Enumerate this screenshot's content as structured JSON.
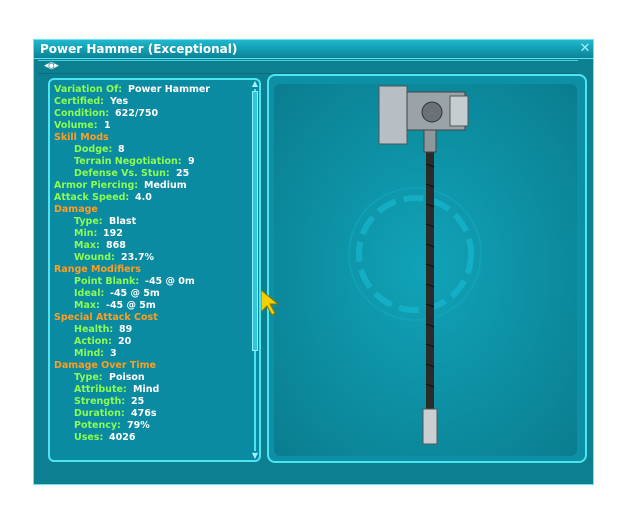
{
  "window": {
    "title": "Power Hammer (Exceptional)"
  },
  "stats": [
    {
      "type": "kv",
      "indent": 0,
      "label": "Variation Of:",
      "value": "Power Hammer"
    },
    {
      "type": "kv",
      "indent": 0,
      "label": "Certified:",
      "value": "Yes"
    },
    {
      "type": "kv",
      "indent": 0,
      "label": "Condition:",
      "value": "622/750"
    },
    {
      "type": "kv",
      "indent": 0,
      "label": "Volume:",
      "value": "1"
    },
    {
      "type": "header",
      "label": "Skill Mods"
    },
    {
      "type": "kv",
      "indent": 1,
      "label": "Dodge:",
      "value": "8"
    },
    {
      "type": "kv",
      "indent": 1,
      "label": "Terrain Negotiation:",
      "value": "9"
    },
    {
      "type": "kv",
      "indent": 1,
      "label": "Defense Vs. Stun:",
      "value": "25"
    },
    {
      "type": "kv",
      "indent": 0,
      "label": "Armor Piercing:",
      "value": "Medium"
    },
    {
      "type": "kv",
      "indent": 0,
      "label": "Attack Speed:",
      "value": "4.0"
    },
    {
      "type": "header",
      "label": "Damage"
    },
    {
      "type": "kv",
      "indent": 1,
      "label": "Type:",
      "value": "Blast"
    },
    {
      "type": "kv",
      "indent": 1,
      "label": "Min:",
      "value": "192"
    },
    {
      "type": "kv",
      "indent": 1,
      "label": "Max:",
      "value": "868"
    },
    {
      "type": "kv",
      "indent": 1,
      "label": "Wound:",
      "value": "23.7%"
    },
    {
      "type": "header",
      "label": "Range Modifiers"
    },
    {
      "type": "kv",
      "indent": 1,
      "label": "Point Blank:",
      "value": "-45 @  0m"
    },
    {
      "type": "kv",
      "indent": 1,
      "label": "Ideal:",
      "value": "-45 @  5m"
    },
    {
      "type": "kv",
      "indent": 1,
      "label": "Max:",
      "value": "-45 @  5m"
    },
    {
      "type": "header",
      "label": "Special Attack Cost"
    },
    {
      "type": "kv",
      "indent": 1,
      "label": "Health:",
      "value": "89"
    },
    {
      "type": "kv",
      "indent": 1,
      "label": "Action:",
      "value": "20"
    },
    {
      "type": "kv",
      "indent": 1,
      "label": "Mind:",
      "value": "3"
    },
    {
      "type": "header",
      "label": "Damage Over Time"
    },
    {
      "type": "kv",
      "indent": 1,
      "label": "Type:",
      "value": "Poison"
    },
    {
      "type": "kv",
      "indent": 1,
      "label": "Attribute:",
      "value": "Mind"
    },
    {
      "type": "kv",
      "indent": 1,
      "label": "Strength:",
      "value": "25"
    },
    {
      "type": "kv",
      "indent": 1,
      "label": "Duration:",
      "value": "476s"
    },
    {
      "type": "kv",
      "indent": 1,
      "label": "Potency:",
      "value": "79%"
    },
    {
      "type": "kv",
      "indent": 1,
      "label": "Uses:",
      "value": "4026"
    }
  ],
  "icons": {
    "close": "close-icon",
    "eye": "eye-icon",
    "scroll_up": "chevron-up-icon",
    "scroll_down": "chevron-down-icon"
  },
  "colors": {
    "label": "#8dfc52",
    "header": "#ff9e20",
    "value": "#ffffff",
    "frame": "#4de4f2",
    "window_bg": "#0c7f91"
  }
}
